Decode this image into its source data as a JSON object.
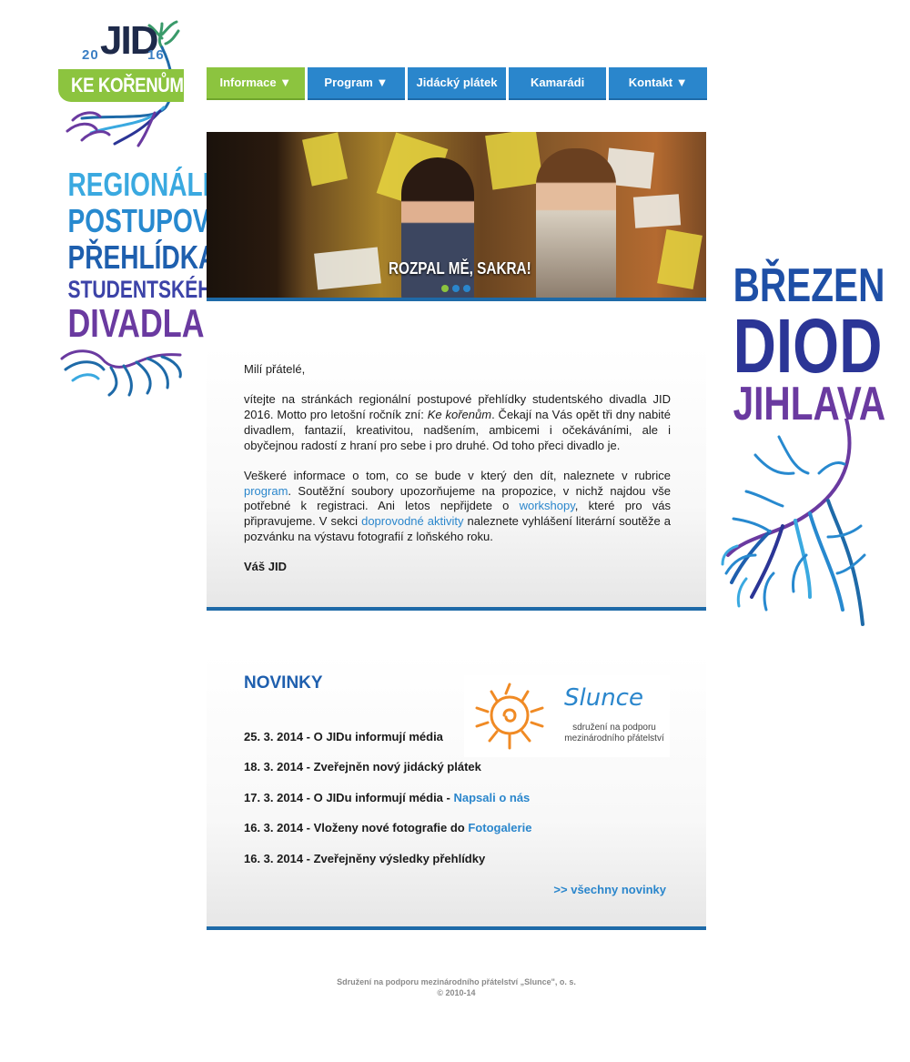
{
  "logo": {
    "year_left": "20",
    "name": "JID",
    "year_right": "16",
    "motto": "KE KOŘENŮM"
  },
  "tagline": {
    "line1": "REGIONÁLNÍ",
    "line2": "POSTUPOVÁ",
    "line3": "PŘEHLÍDKA",
    "line4": "STUDENTSKÉHO",
    "line5": "DIVADLA"
  },
  "event": {
    "month": "BŘEZEN",
    "venue": "DIOD",
    "city": "JIHLAVA"
  },
  "nav": {
    "items": [
      {
        "label": "Informace ▼",
        "active": true
      },
      {
        "label": "Program ▼"
      },
      {
        "label": "Jidácký plátek"
      },
      {
        "label": "Kamarádi"
      },
      {
        "label": "Kontakt ▼"
      }
    ]
  },
  "slider": {
    "caption": "ROZPAL MĚ, SAKRA!",
    "slides": 3,
    "active_slide": 1
  },
  "intro": {
    "greeting": "Milí přátelé,",
    "p1_a": "vítejte na stránkách regionální postupové přehlídky studentského divadla JID 2016. Motto pro letošní ročník zní: ",
    "p1_motto": "Ke kořenům",
    "p1_b": ". Čekají na Vás opět tři dny nabité divadlem, fantazií, kreativitou, nadšením, ambicemi i očekáváními, ale i obyčejnou radostí z hraní pro sebe i pro druhé. Od toho přeci divadlo je.",
    "p2_a": "Veškeré informace o tom, co se bude v který den dít, naleznete v rubrice ",
    "p2_link1": "program",
    "p2_b": ". Soutěžní soubory upozorňujeme na propozice, v nichž najdou vše potřebné k registraci. Ani letos nepřijdete o ",
    "p2_link2": "workshopy",
    "p2_c": ", které pro vás připravujeme. V sekci ",
    "p2_link3": "doprovodné aktivity",
    "p2_d": " naleznete vyhlášení literární soutěže a pozvánku na výstavu fotografií z loňského roku.",
    "signature": "Váš JID"
  },
  "news": {
    "title": "NOVINKY",
    "items": [
      {
        "text": "25. 3. 2014 - O JIDu informují média",
        "link": ""
      },
      {
        "text": "18. 3. 2014 - Zveřejněn nový jidácký plátek",
        "link": ""
      },
      {
        "text": "17. 3. 2014 - O JIDu informují média - ",
        "link": "Napsali o nás"
      },
      {
        "text": "16. 3. 2014 - Vloženy nové fotografie do ",
        "link": "Fotogalerie"
      },
      {
        "text": "16. 3. 2014 - Zveřejněny výsledky přehlídky",
        "link": ""
      }
    ],
    "all_link": ">> všechny novinky"
  },
  "sponsor": {
    "name": "Slunce",
    "subtitle": "sdružení na podporu mezinárodního přátelství"
  },
  "footer": {
    "line1": "Sdružení na podporu mezinárodního přátelství „Slunce\", o. s.",
    "line2": "© 2010-14"
  },
  "colors": {
    "nav_blue": "#2a86cc",
    "nav_active_green": "#8cc43f",
    "bar_blue": "#1e6aa8",
    "heading_blue": "#1e5fae",
    "purple": "#6a3aa0"
  }
}
